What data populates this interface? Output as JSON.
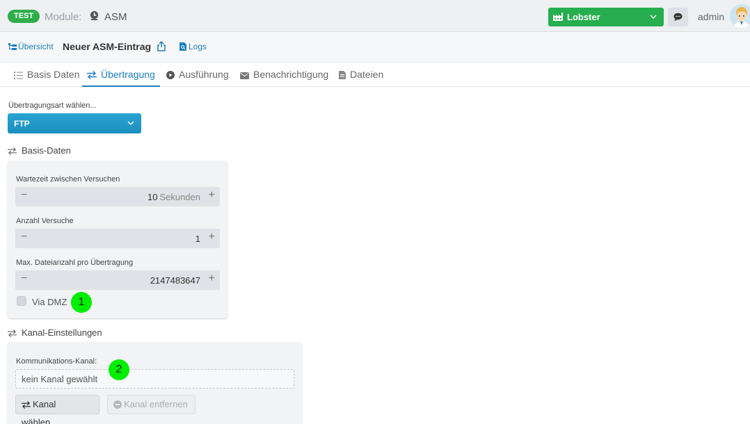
{
  "header": {
    "env_badge": "TEST",
    "module_label": "Module:",
    "module_name": "ASM",
    "tenant": "Lobster",
    "user": "admin",
    "accent_green": "#27ae4f"
  },
  "toolbar": {
    "overview_link": "Übersicht",
    "title": "Neuer ASM-Eintrag",
    "logs_link": "Logs",
    "link_color": "#1a7fbf"
  },
  "tabs": [
    {
      "label": "Basis Daten",
      "icon": "list-icon"
    },
    {
      "label": "Übertragung",
      "icon": "transfer-icon",
      "active": true
    },
    {
      "label": "Ausführung",
      "icon": "play-icon"
    },
    {
      "label": "Benachrichtigung",
      "icon": "envelope-icon"
    },
    {
      "label": "Dateien",
      "icon": "file-icon"
    }
  ],
  "transfer": {
    "type_label": "Übertragungsart wählen...",
    "type_value": "FTP"
  },
  "basis": {
    "section_title": "Basis-Daten",
    "wait_label": "Wartezeit zwischen Versuchen",
    "wait_value": "10",
    "wait_unit": "Sekunden",
    "attempts_label": "Anzahl Versuche",
    "attempts_value": "1",
    "maxfiles_label": "Max. Dateianzahl pro Übertragung",
    "maxfiles_value": "2147483647",
    "dmz_label": "Via DMZ",
    "dmz_checked": false
  },
  "channel": {
    "section_title": "Kanal-Einstellungen",
    "label": "Kommunikations-Kanal:",
    "value": "kein Kanal gewählt",
    "choose_button": "Kanal wählen...",
    "remove_button": "Kanal entfernen"
  },
  "markers": [
    "1",
    "2"
  ]
}
